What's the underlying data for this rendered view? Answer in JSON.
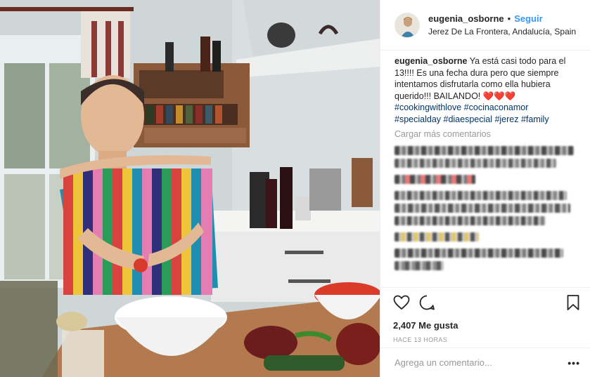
{
  "post": {
    "username": "eugenia_osborne",
    "separator": "•",
    "follow_label": "Seguir",
    "location": "Jerez De La Frontera, Andalucía, Spain"
  },
  "caption": {
    "username": "eugenia_osborne",
    "text": "Ya está casi todo para el 13!!!! Es una fecha dura pero que siempre intentamos disfrutarla como ella hubiera querido!!! BAILANDO! ❤️❤️❤️",
    "hashtags_line1": "#cookingwithlove #cocinaconamor",
    "hashtags_line2": "#specialday #diaespecial #jerez #family"
  },
  "load_more_label": "Cargar más comentarios",
  "likes": "2,407 Me gusta",
  "timestamp": "HACE 13 HORAS",
  "comment_placeholder": "Agrega un comentario...",
  "more_options": "•••",
  "icons": [
    "heart-icon",
    "comment-icon",
    "bookmark-icon",
    "more-options-icon"
  ],
  "colors": {
    "follow_blue": "#3897f0",
    "hashtag_blue": "#003569",
    "muted_gray": "#999999",
    "heart_red": "#ed4956"
  }
}
